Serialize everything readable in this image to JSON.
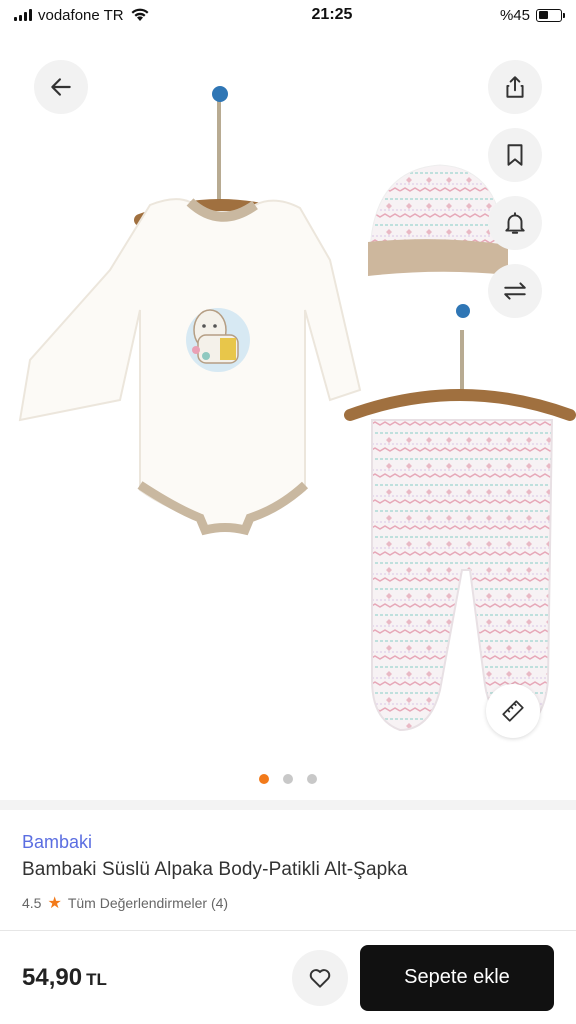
{
  "status_bar": {
    "carrier": "vodafone TR",
    "time": "21:25",
    "battery": "%45",
    "battery_level": 0.45
  },
  "gallery": {
    "images_count": 3,
    "active_index": 0,
    "icons": {
      "back": "arrow-left-icon",
      "share": "share-icon",
      "bookmark": "bookmark-icon",
      "alert": "bell-icon",
      "compare": "compare-arrows-icon",
      "size": "size-ruler-icon"
    }
  },
  "product": {
    "brand": "Bambaki",
    "title": "Bambaki Süslü Alpaka Body-Patikli Alt-Şapka",
    "rating": "4.5",
    "reviews_link": "Tüm Değerlendirmeler (4)"
  },
  "purchase": {
    "price": "54,90",
    "currency": "TL",
    "add_to_cart": "Sepete ekle"
  },
  "colors": {
    "accent": "#f27a1a",
    "brand_link": "#5b6ee1",
    "cart_button": "#111111"
  }
}
